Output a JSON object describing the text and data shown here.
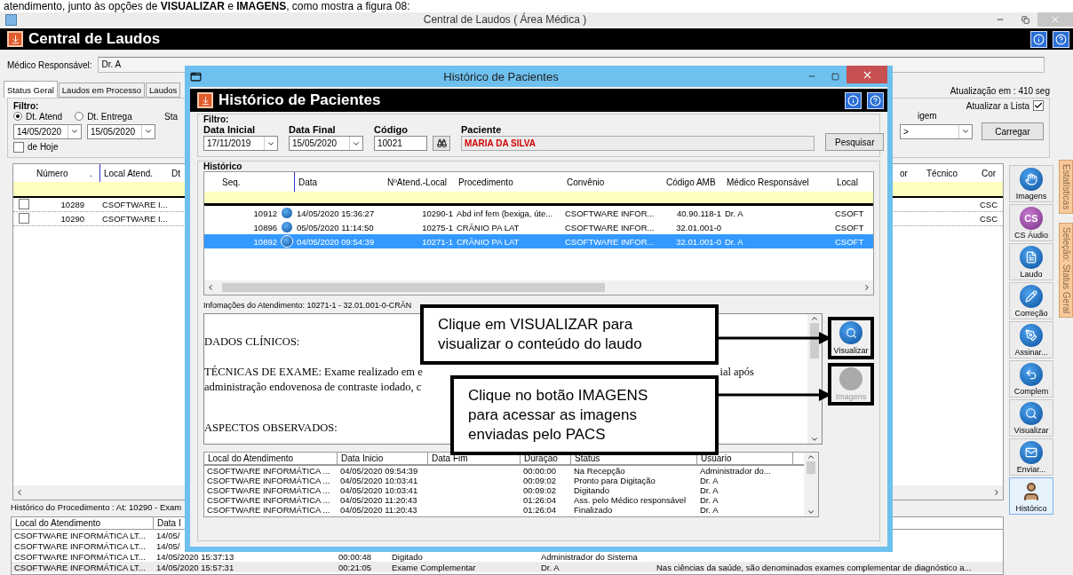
{
  "document_text": "atendimento, junto às opções de **VISUALIZAR** e **IMAGENS**, como mostra a figura 08:",
  "window": {
    "title": "Central de Laudos ( Área Médica )",
    "header": "Central de Laudos"
  },
  "doctor": {
    "label": "Médico Responsável:",
    "value": "Dr. A"
  },
  "tabs": [
    {
      "label": "Status Geral",
      "selected": true
    },
    {
      "label": "Laudos em Processo",
      "selected": false
    },
    {
      "label": "Laudos",
      "selected": false
    }
  ],
  "update_text": "Atualização em : 410 seg",
  "filter": {
    "title": "Filtro:",
    "radios": [
      {
        "label": "Dt. Atend",
        "selected": true
      },
      {
        "label": "Dt. Entrega",
        "selected": false
      }
    ],
    "status_label": "Sta",
    "date_from": "14/05/2020",
    "date_to": "15/05/2020",
    "today": {
      "label": "de Hoje",
      "checked": false
    },
    "auto_refresh": {
      "label": "Atualizar a Lista",
      "checked": true
    },
    "origin_label": "igem",
    "origin_value": ">",
    "load_button": "Carregar"
  },
  "table": {
    "columns": [
      "Número",
      ".",
      "Local Atend.",
      "Dt",
      "or",
      "Técnico",
      "Cor"
    ],
    "rows": [
      {
        "checked": false,
        "cells": [
          "10289",
          "",
          "CSOFTWARE I...",
          "",
          "",
          "",
          "CSC"
        ]
      },
      {
        "checked": false,
        "cells": [
          "10290",
          "",
          "CSOFTWARE I...",
          "",
          "",
          "",
          "CSC"
        ]
      }
    ]
  },
  "toolbar": [
    {
      "label": "Imagens",
      "kind": "hand",
      "selected": false
    },
    {
      "label": "CS Áudio",
      "kind": "badge",
      "badge": "CS",
      "selected": false
    },
    {
      "label": "Laudo",
      "kind": "document",
      "selected": false
    },
    {
      "label": "Correção",
      "kind": "edit",
      "selected": false
    },
    {
      "label": "Assinar...",
      "kind": "sign",
      "selected": false
    },
    {
      "label": "Complem",
      "kind": "add",
      "selected": false
    },
    {
      "label": "Visualizar",
      "kind": "view",
      "selected": false
    },
    {
      "label": "Enviar...",
      "kind": "mail",
      "selected": false
    },
    {
      "label": "Histórico",
      "kind": "user",
      "selected": true
    }
  ],
  "side_tabs": [
    "Estatísticas",
    "Seleção: Status Geral"
  ],
  "procedure_history": {
    "title": "Histórico do Procedimento : At: 10290 - Exam",
    "columns": [
      "Local do Atendimento",
      "Data I"
    ],
    "rows": [
      [
        "CSOFTWARE INFORMÁTICA LT...",
        "14/05/"
      ],
      [
        "CSOFTWARE INFORMÁTICA LT...",
        "14/05/"
      ],
      [
        "CSOFTWARE INFORMÁTICA LT...",
        "14/05/2020 15:37:13",
        "00:00:48",
        "Digitado",
        "Administrador do Sistema"
      ],
      [
        "CSOFTWARE INFORMÁTICA LT...",
        "14/05/2020 15:57:31",
        "00:21:05",
        "Exame Complementar",
        "Dr. A",
        "Nas ciências da saúde, são denominados exames complementar de diagnóstico a..."
      ]
    ]
  },
  "dialog": {
    "title": "Histórico de Pacientes",
    "header": "Histórico de Pacientes",
    "filter": {
      "title": "Filtro:",
      "date_from_label": "Data Inicial",
      "date_from": "17/11/2019",
      "date_to_label": "Data Final",
      "date_to": "15/05/2020",
      "code_label": "Código",
      "code": "10021",
      "patient_label": "Paciente",
      "patient": "MARIA DA SILVA",
      "search_button": "Pesquisar"
    },
    "history": {
      "title": "Histórico",
      "columns": [
        "Seq.",
        "Data",
        "NºAtend.-Local",
        "Procedimento",
        "Convênio",
        "Código AMB",
        "Médico Responsável",
        "Local"
      ],
      "rows": [
        {
          "selected": false,
          "cells": [
            "10912",
            "14/05/2020 15:36:27",
            "10290-1",
            "Abd inf fem (bexiga, úte...",
            "CSOFTWARE INFOR...",
            "40.90.118-1",
            "Dr. A",
            "CSOFT"
          ]
        },
        {
          "selected": false,
          "cells": [
            "10896",
            "05/05/2020 11:14:50",
            "10275-1",
            "CRÂNIO PA LAT",
            "CSOFTWARE INFOR...",
            "32.01.001-0",
            "",
            "CSOFT"
          ]
        },
        {
          "selected": true,
          "cells": [
            "10892",
            "04/05/2020 09:54:39",
            "10271-1",
            "CRÂNIO PA LAT",
            "CSOFTWARE INFOR...",
            "32.01.001-0",
            "Dr. A",
            "CSOFT"
          ]
        }
      ]
    },
    "info_label": "Infomações do Atendimento: 10271-1 - 32.01.001-0-CRÂN",
    "report_lines": [
      [
        "DADOS CLÍNICOS:"
      ],
      [
        "TÉCNICAS DE EXAME: Exame realizado em e",
        "ial após"
      ],
      [
        "administração endovenosa de contraste iodado, c"
      ],
      [
        "ASPECTOS OBSERVADOS:"
      ]
    ],
    "buttons": [
      {
        "label": "Visualizar",
        "disabled": false
      },
      {
        "label": "Imagens",
        "disabled": true
      }
    ],
    "status_table": {
      "columns": [
        "Local do Atendimento",
        "Data Inicio",
        "Data Fim",
        "Duração",
        "Status",
        "Usuario"
      ],
      "rows": [
        [
          "CSOFTWARE INFORMÁTICA ...",
          "04/05/2020 09:54:39",
          "",
          "00:00:00",
          "Na Recepção",
          "Administrador do..."
        ],
        [
          "CSOFTWARE INFORMÁTICA ...",
          "04/05/2020 10:03:41",
          "",
          "00:09:02",
          "Pronto para Digitação",
          "Dr. A"
        ],
        [
          "CSOFTWARE INFORMÁTICA ...",
          "04/05/2020 10:03:41",
          "",
          "00:09:02",
          "Digitando",
          "Dr. A"
        ],
        [
          "CSOFTWARE INFORMÁTICA ...",
          "04/05/2020 11:20:43",
          "",
          "01:26:04",
          "Ass. pelo Médico responsável",
          "Dr. A"
        ],
        [
          "CSOFTWARE INFORMÁTICA ...",
          "04/05/2020 11:20:43",
          "",
          "01:26:04",
          "Finalizado",
          "Dr. A"
        ]
      ]
    }
  },
  "callouts": [
    "Clique em VISUALIZAR para visualizar o conteúdo do laudo",
    "Clique no botão IMAGENS para acessar as imagens enviadas pelo PACS"
  ]
}
